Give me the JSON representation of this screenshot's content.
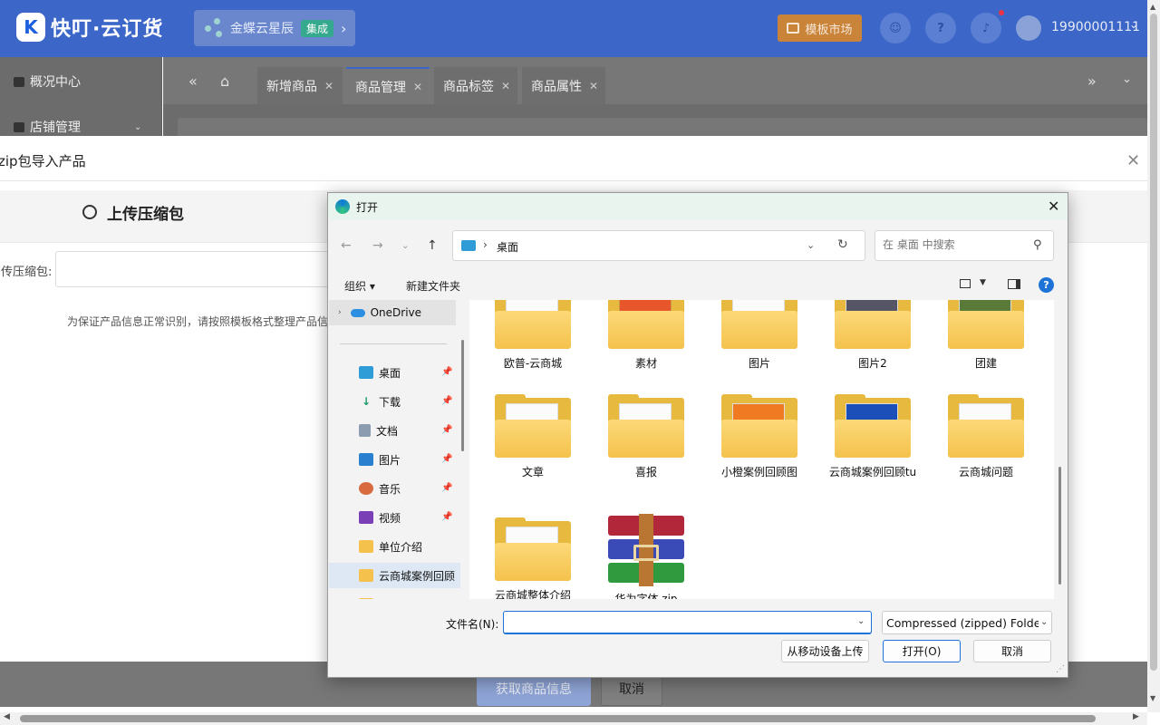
{
  "header": {
    "logo_mark": "K",
    "logo_text": "快叮·云订货",
    "kingdee_name": "金蝶云星辰",
    "kingdee_badge": "集成",
    "template_market": "模板市场",
    "user_name": "19900001111"
  },
  "sidebar": {
    "items": [
      {
        "label": "概况中心"
      },
      {
        "label": "店铺管理"
      }
    ]
  },
  "tabs": [
    {
      "label": "新增商品"
    },
    {
      "label": "商品管理"
    },
    {
      "label": "商品标签"
    },
    {
      "label": "商品属性"
    }
  ],
  "zip_dialog": {
    "title": "zip包导入产品",
    "step_label": "上传压缩包",
    "upload_label": "传压缩包:",
    "hint": "为保证产品信息正常识别，请按照模板格式整理产品信",
    "fetch_button": "获取商品信息",
    "cancel_button": "取消"
  },
  "file_dialog": {
    "title": "打开",
    "breadcrumb": "桌面",
    "search_placeholder": "在 桌面 中搜索",
    "toolbar": {
      "organize": "组织",
      "new_folder": "新建文件夹"
    },
    "nav": {
      "onedrive": "OneDrive",
      "items": [
        {
          "label": "桌面",
          "pinned": true
        },
        {
          "label": "下载",
          "pinned": true
        },
        {
          "label": "文档",
          "pinned": true
        },
        {
          "label": "图片",
          "pinned": true
        },
        {
          "label": "音乐",
          "pinned": true
        },
        {
          "label": "视频",
          "pinned": true
        },
        {
          "label": "单位介绍",
          "pinned": false
        },
        {
          "label": "云商城案例回顾",
          "pinned": false,
          "selected": true
        }
      ]
    },
    "files": [
      {
        "name": "欧普-云商城",
        "type": "folder"
      },
      {
        "name": "素材",
        "type": "folder"
      },
      {
        "name": "图片",
        "type": "folder"
      },
      {
        "name": "图片2",
        "type": "folder"
      },
      {
        "name": "团建",
        "type": "folder"
      },
      {
        "name": "文章",
        "type": "folder"
      },
      {
        "name": "喜报",
        "type": "folder"
      },
      {
        "name": "小橙案例回顾图",
        "type": "folder"
      },
      {
        "name": "云商城案例回顾tu",
        "type": "folder"
      },
      {
        "name": "云商城问题",
        "type": "folder"
      },
      {
        "name": "云商城整体介绍",
        "type": "folder"
      },
      {
        "name": "华为字体.zip",
        "type": "zip"
      }
    ],
    "filename_label": "文件名(N):",
    "filename_value": "",
    "filetype": "Compressed (zipped) Folder",
    "upload_mobile": "从移动设备上传",
    "open_button": "打开(O)",
    "cancel_button": "取消"
  },
  "colors": {
    "brand": "#1e5fe0",
    "dialog_accent": "#1e74d6",
    "folder": "#f4c24c"
  }
}
